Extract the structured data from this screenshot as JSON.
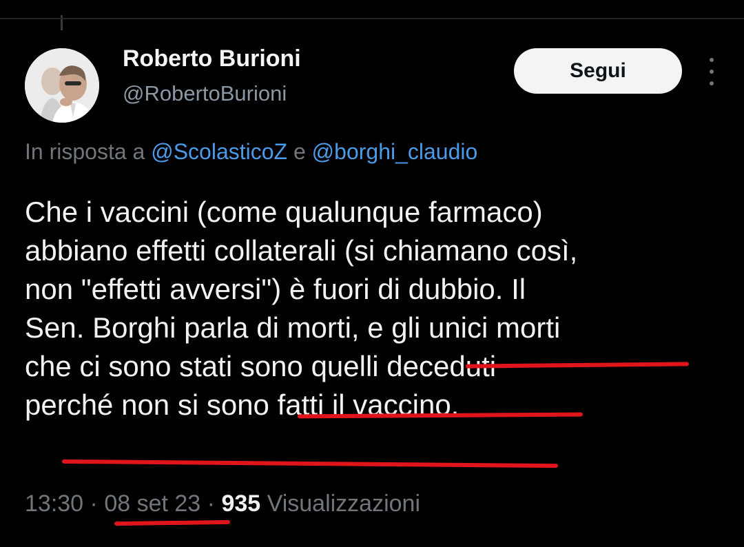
{
  "author": {
    "name": "Roberto Burioni",
    "handle": "@RobertoBurioni",
    "follow_label": "Segui",
    "more_icon": "more-vertical-icon"
  },
  "reply": {
    "prefix": "In risposta a",
    "mention1": "@ScolasticoZ",
    "conj": "e",
    "mention2": "@borghi_claudio"
  },
  "tweet": {
    "line1": "Che i vaccini (come qualunque farmaco)",
    "line2": "abbiano effetti collaterali (si chiamano così,",
    "line3": "non \"effetti avversi\") è fuori di dubbio. Il",
    "line4a": "Sen. Borghi parla di morti, e ",
    "line4b": "gli unici morti",
    "line5a": "che ci sono stati ",
    "line5b": "sono quelli deceduti",
    "line6": "perché non si sono fatti il vaccino."
  },
  "meta": {
    "time": "13:30",
    "sep": "·",
    "date": "08 set 23",
    "views_count": "935",
    "views_label": "Visualizzazioni"
  },
  "colors": {
    "background": "#000000",
    "link": "#4c9be8",
    "muted": "#71767b",
    "underline": "#e0141b"
  }
}
